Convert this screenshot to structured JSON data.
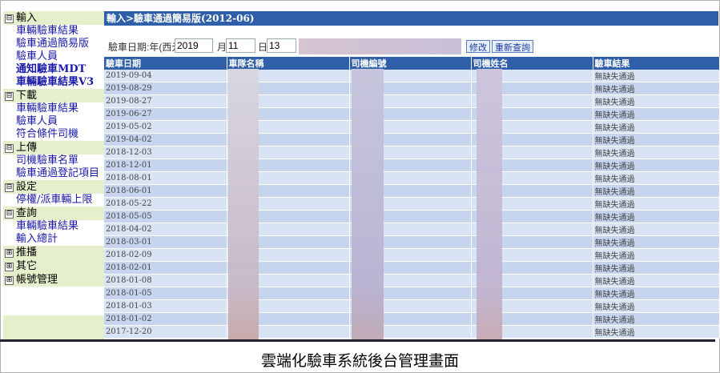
{
  "sidebar": {
    "sections": [
      {
        "label": "輸入",
        "toggle": "⊟",
        "items": [
          {
            "label": "車輛驗車結果",
            "bold": false
          },
          {
            "label": "驗車通過簡易版",
            "bold": false
          },
          {
            "label": "驗車人員",
            "bold": false
          },
          {
            "label": "通知驗車MDT",
            "bold": true
          },
          {
            "label": "車輛驗車結果V3",
            "bold": true
          }
        ]
      },
      {
        "label": "下載",
        "toggle": "⊟",
        "items": [
          {
            "label": "車輛驗車結果",
            "bold": false
          },
          {
            "label": "驗車人員",
            "bold": false
          },
          {
            "label": "符合條件司機",
            "bold": false
          }
        ]
      },
      {
        "label": "上傳",
        "toggle": "⊟",
        "items": [
          {
            "label": "司機驗車名單",
            "bold": false
          },
          {
            "label": "驗車通過登記項目",
            "bold": false
          }
        ]
      },
      {
        "label": "設定",
        "toggle": "⊟",
        "items": [
          {
            "label": "停權/派車輛上限",
            "bold": false
          }
        ]
      },
      {
        "label": "查詢",
        "toggle": "⊟",
        "items": [
          {
            "label": "車輛驗車結果",
            "bold": false
          },
          {
            "label": "輸入總計",
            "bold": false
          }
        ]
      },
      {
        "label": "推播",
        "toggle": "⊞",
        "items": []
      },
      {
        "label": "其它",
        "toggle": "⊞",
        "items": []
      },
      {
        "label": "帳號管理",
        "toggle": "⊞",
        "items": []
      }
    ]
  },
  "breadcrumb": "輸入>驗車通過簡易版(2012-06)",
  "filter": {
    "date_label": "驗車日期:年(西元)",
    "year": "2019",
    "month_label": "月",
    "month": "11",
    "day_label": "日",
    "day": "13",
    "modify_button": "修改",
    "requery_button": "重新查詢"
  },
  "table": {
    "columns": [
      "驗車日期",
      "車隊名稱",
      "司機編號",
      "司機姓名",
      "驗車結果"
    ],
    "rows": [
      [
        "2019-09-04",
        "",
        "",
        "",
        "無缺失通過"
      ],
      [
        "2019-08-29",
        "",
        "",
        "",
        "無缺失通過"
      ],
      [
        "2019-08-27",
        "",
        "",
        "",
        "無缺失通過"
      ],
      [
        "2019-06-27",
        "",
        "",
        "",
        "無缺失通過"
      ],
      [
        "2019-05-02",
        "",
        "",
        "",
        "無缺失通過"
      ],
      [
        "2019-04-02",
        "",
        "",
        "",
        "無缺失通過"
      ],
      [
        "2018-12-03",
        "",
        "",
        "",
        "無缺失通過"
      ],
      [
        "2018-12-01",
        "",
        "",
        "",
        "無缺失通過"
      ],
      [
        "2018-08-01",
        "",
        "",
        "",
        "無缺失通過"
      ],
      [
        "2018-06-01",
        "",
        "",
        "",
        "無缺失通過"
      ],
      [
        "2018-05-22",
        "",
        "",
        "",
        "無缺失通過"
      ],
      [
        "2018-05-05",
        "",
        "",
        "",
        "無缺失通過"
      ],
      [
        "2018-04-02",
        "",
        "",
        "",
        "無缺失通過"
      ],
      [
        "2018-03-01",
        "",
        "",
        "",
        "無缺失通過"
      ],
      [
        "2018-02-09",
        "",
        "",
        "",
        "無缺失通過"
      ],
      [
        "2018-02-01",
        "",
        "",
        "",
        "無缺失通過"
      ],
      [
        "2018-01-08",
        "",
        "",
        "",
        "無缺失通過"
      ],
      [
        "2018-01-05",
        "",
        "",
        "",
        "無缺失通過"
      ],
      [
        "2018-01-03",
        "",
        "",
        "",
        "無缺失通過"
      ],
      [
        "2018-01-02",
        "",
        "",
        "",
        "無缺失通過"
      ],
      [
        "2017-12-20",
        "",
        "",
        "",
        "無缺失通過"
      ]
    ]
  },
  "caption": "雲端化驗車系統後台管理畫面",
  "colors": {
    "header_blue": "#2f5fa8",
    "sidebar_head": "#e6efcc",
    "row_light": "#d8e4f4",
    "row_dark": "#c6d4ee",
    "link": "#1a1aa8"
  }
}
